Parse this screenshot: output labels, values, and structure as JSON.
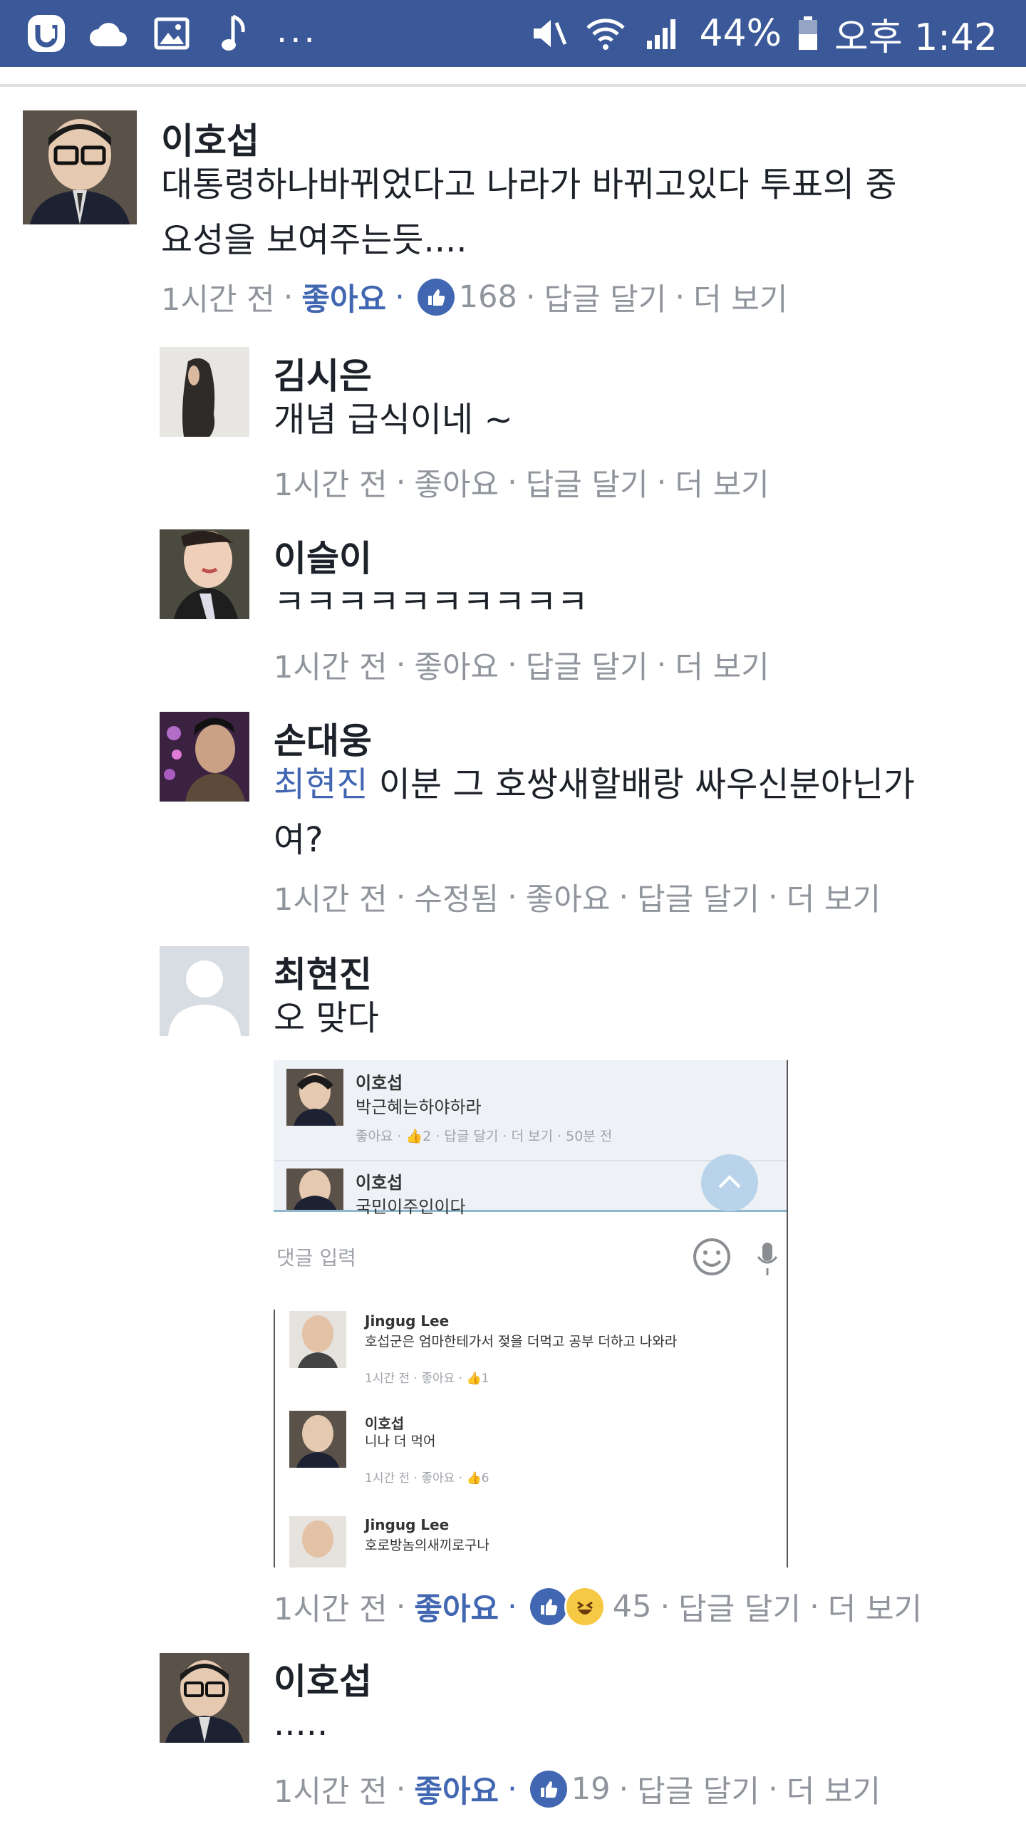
{
  "status_bar": {
    "battery": "44%",
    "time": "오후 1:42",
    "left_icons": [
      "u-plus-icon",
      "cloud-icon",
      "image-icon",
      "music-note-icon"
    ],
    "more": "...",
    "right_icons": [
      "mute-icon",
      "wifi-icon",
      "signal-icon",
      "battery-icon"
    ]
  },
  "colors": {
    "status_bar": "#3b5998",
    "link": "#4267b2",
    "meta": "#90949c"
  },
  "comments": [
    {
      "name": "이호섭",
      "lines": [
        "대통령하나바뀌었다고 나라가 바뀌고있다 투표의 중",
        "요성을 보여주는듯...."
      ],
      "time": "1시간 전",
      "like": "좋아요",
      "like_count": "168",
      "reply": "답글 달기",
      "more": "더 보기",
      "liked": true
    },
    {
      "name": "김시은",
      "lines": [
        "개념 급식이네 ~"
      ],
      "time": "1시간 전",
      "like": "좋아요",
      "reply": "답글 달기",
      "more": "더 보기"
    },
    {
      "name": "이슬이",
      "lines": [
        "ㅋㅋㅋㅋㅋㅋㅋㅋㅋㅋ"
      ],
      "time": "1시간 전",
      "like": "좋아요",
      "reply": "답글 달기",
      "more": "더 보기"
    },
    {
      "name": "손대웅",
      "mention": "최현진",
      "lines": [
        " 이분 그 호쌍새할배랑 싸우신분아닌가",
        "여?"
      ],
      "time": "1시간 전",
      "edited": "수정됨",
      "like": "좋아요",
      "reply": "답글 달기",
      "more": "더 보기"
    },
    {
      "name": "최현진",
      "lines": [
        "오 맞다"
      ],
      "time": "1시간 전",
      "like": "좋아요",
      "like_count": "45",
      "reply": "답글 달기",
      "more": "더 보기",
      "liked": true
    },
    {
      "name": "이호섭",
      "lines": [
        "....."
      ],
      "time": "1시간 전",
      "like": "좋아요",
      "like_count": "19",
      "reply": "답글 달기",
      "more": "더 보기",
      "liked": true
    }
  ],
  "attached_image": {
    "items": [
      {
        "name": "이호섭",
        "text": "박근혜는하야하라",
        "meta": "좋아요 · 👍2 · 답글 달기 · 더 보기 · 50분 전"
      },
      {
        "name": "이호섭",
        "text": "국민이주인이다"
      }
    ],
    "input_placeholder": "댓글 입력",
    "replies": [
      {
        "name": "Jingug Lee",
        "text": "호섭군은 엄마한테가서 젖을 더먹고 공부 더하고 나와라",
        "meta": "1시간 전 · 좋아요 · 👍1"
      },
      {
        "name": "이호섭",
        "text": "니나 더 먹어",
        "meta": "1시간 전 · 좋아요 · 👍6"
      },
      {
        "name": "Jingug Lee",
        "text": "호로방놈의새끼로구나"
      }
    ]
  }
}
